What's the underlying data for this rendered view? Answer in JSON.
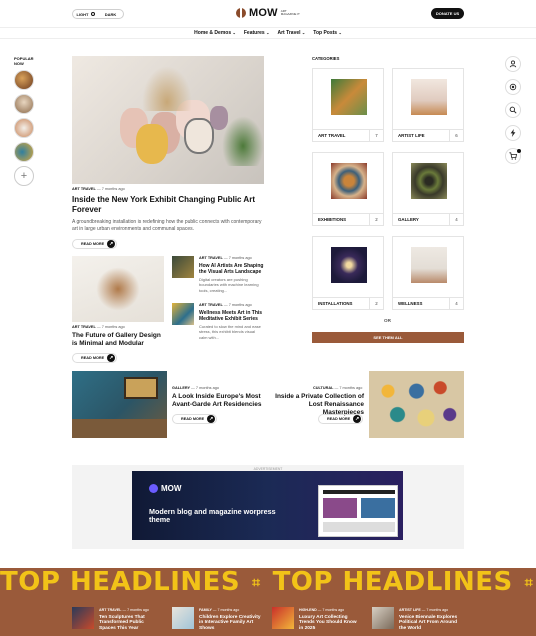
{
  "header": {
    "mode_light": "LIGHT",
    "mode_dark": "DARK",
    "logo_text": "MOW",
    "logo_sub": "ART MAGAZINE IT",
    "donate": "DONATE US"
  },
  "nav": [
    {
      "label": "Home & Demos"
    },
    {
      "label": "Features"
    },
    {
      "label": "Art Travel"
    },
    {
      "label": "Top Posts"
    }
  ],
  "popular": {
    "label": "POPULAR NOW",
    "add": "+"
  },
  "rail_icons": [
    "user-icon",
    "wifi-icon",
    "search-icon",
    "bolt-icon",
    "cart-icon"
  ],
  "hero": {
    "category": "ART TRAVEL",
    "time": "7 months ago",
    "title": "Inside the New York Exhibit Changing Public Art Forever",
    "excerpt": "A groundbreaking installation is redefining how the public connects with contemporary art in large urban environments and communal spaces.",
    "read_more": "READ MORE"
  },
  "card2": {
    "category": "ART TRAVEL",
    "time": "7 months ago",
    "title": "The Future of Gallery Design is Minimal and Modular",
    "read_more": "READ MORE"
  },
  "mini_posts": [
    {
      "category": "ART TRAVEL",
      "time": "7 months ago",
      "title": "How AI Artists Are Shaping the Visual Arts Landscape",
      "excerpt": "Digital creators are pushing boundaries with machine learning tools, creating..."
    },
    {
      "category": "ART TRAVEL",
      "time": "7 months ago",
      "title": "Wellness Meets Art in This Meditative Exhibit Series",
      "excerpt": "Curated to slow the mind and ease stress, this exhibit blends visual calm with..."
    }
  ],
  "categories": {
    "title": "CATEGORIES",
    "items": [
      {
        "name": "ART TRAVEL",
        "count": "7"
      },
      {
        "name": "ARTIST LIFE",
        "count": "6"
      },
      {
        "name": "EXHIBITIONS",
        "count": "2"
      },
      {
        "name": "GALLERY",
        "count": "4"
      },
      {
        "name": "INSTALLATIONS",
        "count": "2"
      },
      {
        "name": "WELLNESS",
        "count": "4"
      }
    ],
    "or": "OR",
    "see_all": "SEE THEM ALL"
  },
  "features": [
    {
      "category": "GALLERY",
      "time": "7 months ago",
      "title": "A Look Inside Europe's Most Avant-Garde Art Residencies",
      "read_more": "READ MORE"
    },
    {
      "category": "CULTURAL",
      "time": "7 months ago",
      "title": "Inside a Private Collection of Lost Renaissance Masterpieces",
      "read_more": "READ MORE"
    }
  ],
  "ad": {
    "label": "ADVERTISEMENT",
    "logo": "MOW",
    "headline": "Modern blog and magazine worpress theme"
  },
  "ticker": {
    "text": "TOP HEADLINES",
    "separator": "⌗"
  },
  "bottom_posts": [
    {
      "category": "ART TRAVEL",
      "time": "7 months ago",
      "title": "Ten Sculptures That Transformed Public Spaces This Year"
    },
    {
      "category": "FAMILY",
      "time": "7 months ago",
      "title": "Children Explore Creativity in Interactive Family Art Shows"
    },
    {
      "category": "HIGH-END",
      "time": "7 months ago",
      "title": "Luxury Art Collecting Trends You Should Know in 2025"
    },
    {
      "category": "ARTIST LIFE",
      "time": "7 months ago",
      "title": "Venice Biennale Explores Political Art From Around the World"
    }
  ],
  "colors": {
    "accent": "#9a5a3a",
    "ticker_text": "#f2c318",
    "dark": "#111111"
  }
}
